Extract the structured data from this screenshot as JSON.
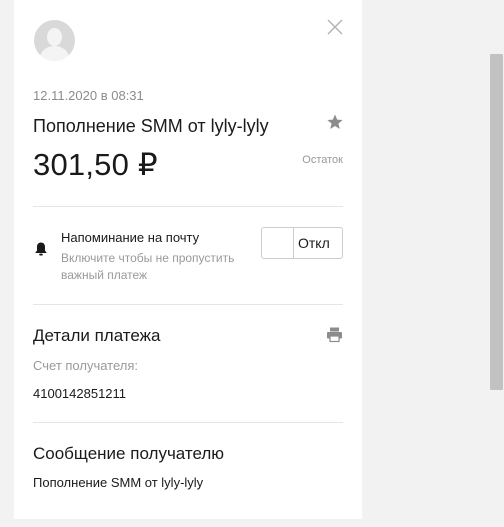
{
  "payment": {
    "date": "12.11.2020 в 08:31",
    "title": "Пополнение SMM от lyly-lyly",
    "amount": "301,50 ₽",
    "remainder_label": "Остаток"
  },
  "reminder": {
    "title": "Напоминание на почту",
    "hint": "Включите чтобы не пропустить важный платеж",
    "toggle_label": "Откл"
  },
  "details": {
    "title": "Детали платежа",
    "recipient_account_label": "Счет получателя:",
    "recipient_account_value": "4100142851211"
  },
  "message": {
    "title": "Сообщение получателю",
    "text": "Пополнение SMM от lyly-lyly"
  },
  "icons": {
    "close": "close-icon",
    "star": "star-icon",
    "bell": "bell-icon",
    "print": "printer-icon",
    "avatar": "avatar-icon"
  },
  "colors": {
    "background": "#f2f2f2",
    "panel": "#ffffff",
    "muted_text": "#999999",
    "divider": "#e5e5e5"
  }
}
